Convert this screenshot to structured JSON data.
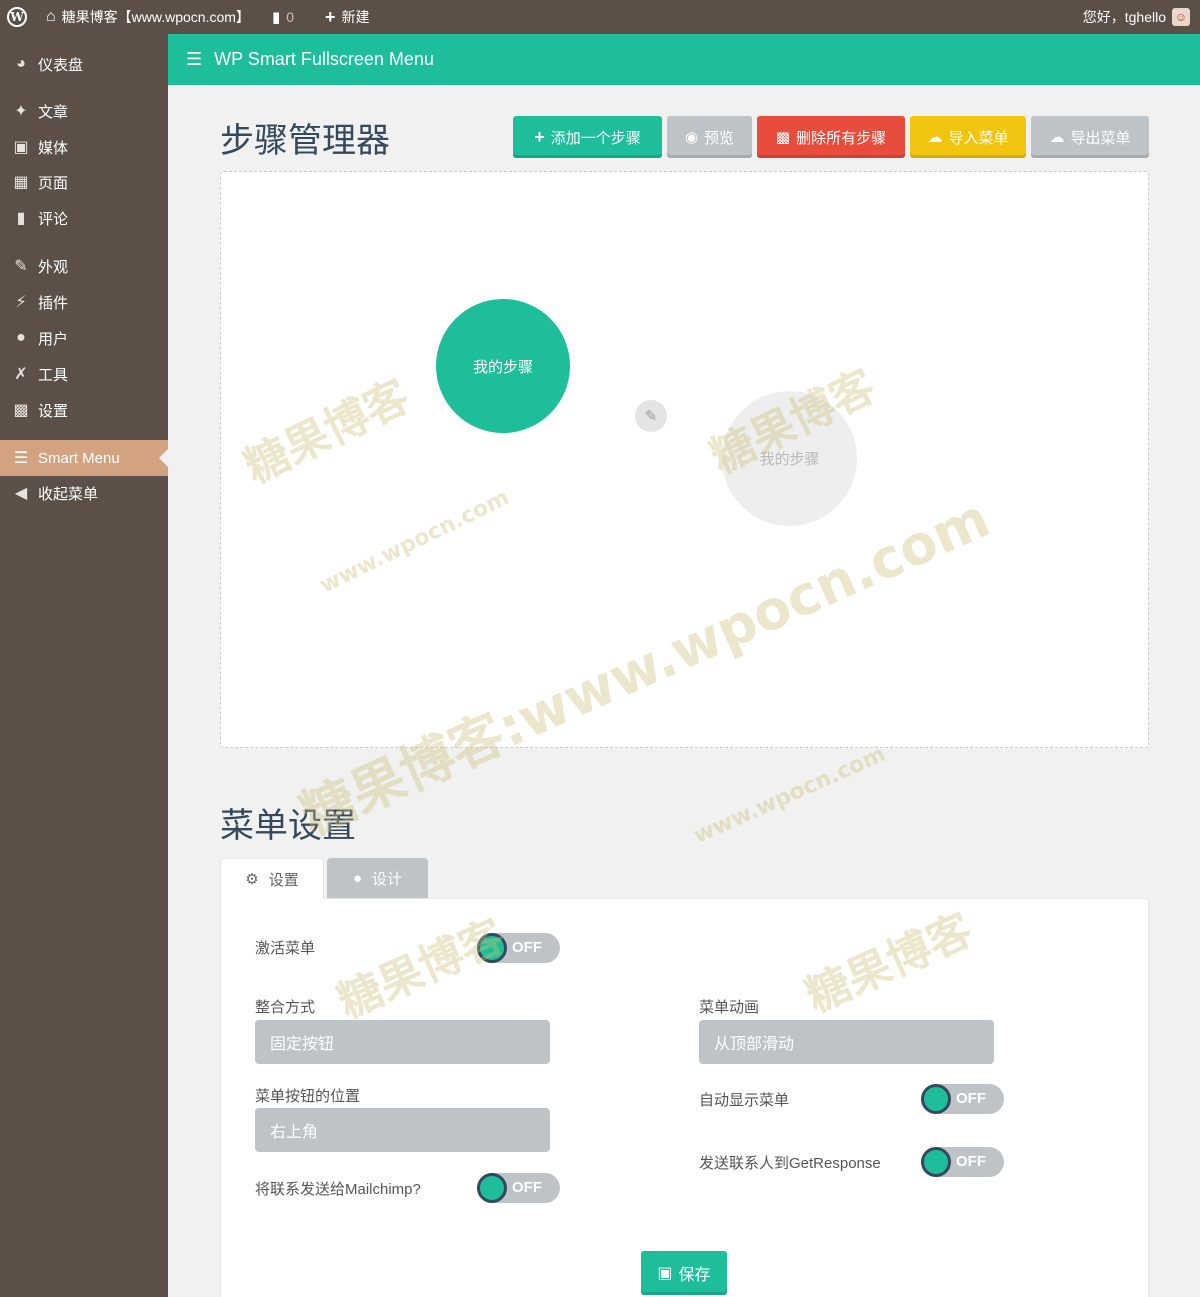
{
  "admin_bar": {
    "site_title": "糖果博客【www.wpocn.com】",
    "comments_count": "0",
    "new_label": "新建",
    "greeting": "您好，tghello"
  },
  "sidebar": {
    "items": [
      {
        "label": "仪表盘",
        "icon": "dashboard-icon"
      },
      {
        "label": "文章",
        "icon": "pin-icon"
      },
      {
        "label": "媒体",
        "icon": "media-icon"
      },
      {
        "label": "页面",
        "icon": "page-icon"
      },
      {
        "label": "评论",
        "icon": "comment-icon"
      },
      {
        "label": "外观",
        "icon": "brush-icon"
      },
      {
        "label": "插件",
        "icon": "plugin-icon"
      },
      {
        "label": "用户",
        "icon": "user-icon"
      },
      {
        "label": "工具",
        "icon": "wrench-icon"
      },
      {
        "label": "设置",
        "icon": "settings-icon"
      },
      {
        "label": "Smart Menu",
        "icon": "menu-icon",
        "active": true
      },
      {
        "label": "收起菜单",
        "icon": "collapse-icon"
      }
    ]
  },
  "plugin_header": {
    "title": "WP Smart Fullscreen Menu"
  },
  "step_manager": {
    "title": "步骤管理器",
    "buttons": {
      "add": "添加一个步骤",
      "preview": "预览",
      "delete_all": "删除所有步骤",
      "import": "导入菜单",
      "export": "导出菜单"
    },
    "nodes": [
      {
        "label": "我的步骤",
        "state": "active"
      },
      {
        "label": "我的步骤",
        "state": "inactive"
      }
    ]
  },
  "menu_settings": {
    "title": "菜单设置",
    "tabs": {
      "settings": "设置",
      "design": "设计"
    },
    "activate_label": "激活菜单",
    "activate_value": "OFF",
    "integration_label": "整合方式",
    "integration_value": "固定按钮",
    "animation_label": "菜单动画",
    "animation_value": "从顶部滑动",
    "position_label": "菜单按钮的位置",
    "position_value": "右上角",
    "auto_show_label": "自动显示菜单",
    "auto_show_value": "OFF",
    "mailchimp_label": "将联系发送给Mailchimp?",
    "mailchimp_value": "OFF",
    "getresponse_label": "发送联系人到GetResponse",
    "getresponse_value": "OFF",
    "save_label": "保存"
  },
  "watermarks": {
    "brand": "糖果博客",
    "url": "www.wpocn.com",
    "combined": "糖果博客:www.wpocn.com"
  },
  "colors": {
    "accent": "#1dbe99",
    "sidebar": "#5b4f48",
    "active_menu": "#d3a280",
    "danger": "#e74c3c",
    "warning": "#f1c40f",
    "neutral": "#bdc3c7",
    "heading": "#34495e"
  }
}
